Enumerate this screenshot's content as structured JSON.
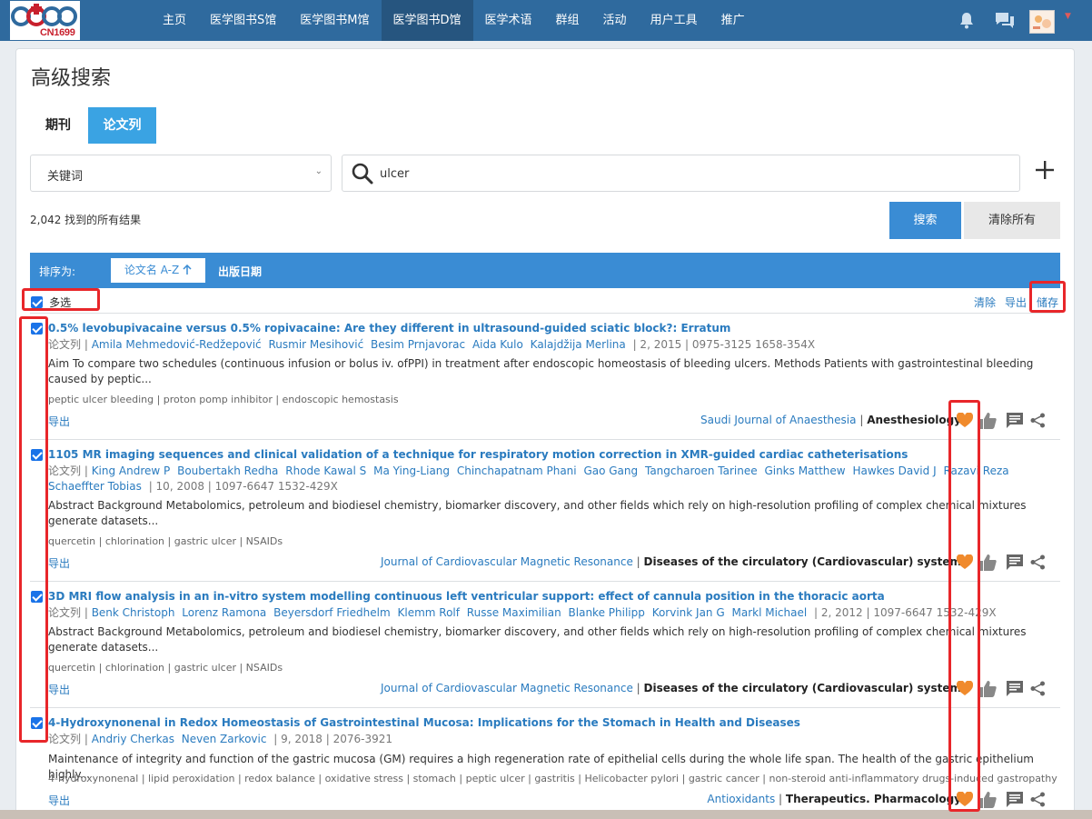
{
  "logo": {
    "text": "CN1699"
  },
  "nav": {
    "items": [
      "主页",
      "医学图书S馆",
      "医学图书M馆",
      "医学图书D馆",
      "医学术语",
      "群组",
      "活动",
      "用户工具",
      "推广"
    ],
    "active_index": 3
  },
  "page": {
    "title": "高级搜索",
    "tabs": [
      "期刊",
      "论文列"
    ],
    "active_tab_index": 1,
    "field_select": "关键词",
    "search_value": "ulcer",
    "result_count": "2,042 找到的所有结果",
    "search_button": "搜索",
    "clear_all_button": "清除所有"
  },
  "sort": {
    "label": "排序为:",
    "option_title": "论文名 A-Z",
    "option_date": "出版日期"
  },
  "list_actions": {
    "multi_select": "多选",
    "clear": "清除",
    "export": "导出",
    "save": "储存"
  },
  "results": [
    {
      "title": "0.5% levobupivacaine versus 0.5% ropivacaine: Are they different in ultrasound-guided sciatic block?: Erratum",
      "type": "论文列 |",
      "authors": [
        "Amila Mehmedović-Redžepović",
        "Rusmir Mesihović",
        "Besim Prnjavorac",
        "Aida Kulo",
        "Kalajdžija Merlina"
      ],
      "meta": "| 2, 2015 | 0975-3125 1658-354X",
      "abstract": "Aim To compare two schedules (continuous infusion or bolus iv. ofPPI) in treatment after endoscopic homeostasis of bleeding ulcers. Methods Patients with gastrointestinal bleeding caused by peptic...",
      "keywords": "peptic ulcer bleeding | proton pomp inhibitor | endoscopic hemostasis",
      "export": "导出",
      "journal": "Saudi Journal of Anaesthesia",
      "category": "Anesthesiology"
    },
    {
      "title": "1105 MR imaging sequences and clinical validation of a technique for respiratory motion correction in XMR-guided cardiac catheterisations",
      "type": "论文列 |",
      "authors": [
        "King Andrew P",
        "Boubertakh Redha",
        "Rhode Kawal S",
        "Ma Ying-Liang",
        "Chinchapatnam Phani",
        "Gao Gang",
        "Tangcharoen Tarinee",
        "Ginks Matthew",
        "Hawkes David J",
        "Razavi Reza",
        "Schaeffter Tobias"
      ],
      "meta": "| 10, 2008 | 1097-6647 1532-429X",
      "abstract": "Abstract Background Metabolomics, petroleum and biodiesel chemistry, biomarker discovery, and other fields which rely on high-resolution profiling of complex chemical mixtures generate datasets...",
      "keywords": "quercetin | chlorination | gastric ulcer | NSAIDs",
      "export": "导出",
      "journal": "Journal of Cardiovascular Magnetic Resonance",
      "category": "Diseases of the circulatory (Cardiovascular) system"
    },
    {
      "title": "3D MRI flow analysis in an in-vitro system modelling continuous left ventricular support: effect of cannula position in the thoracic aorta",
      "type": "论文列 |",
      "authors": [
        "Benk Christoph",
        "Lorenz Ramona",
        "Beyersdorf Friedhelm",
        "Klemm Rolf",
        "Russe Maximilian",
        "Blanke Philipp",
        "Korvink Jan G",
        "Markl Michael"
      ],
      "meta": "| 2, 2012 | 1097-6647 1532-429X",
      "abstract": "Abstract Background Metabolomics, petroleum and biodiesel chemistry, biomarker discovery, and other fields which rely on high-resolution profiling of complex chemical mixtures generate datasets...",
      "keywords": "quercetin | chlorination | gastric ulcer | NSAIDs",
      "export": "导出",
      "journal": "Journal of Cardiovascular Magnetic Resonance",
      "category": "Diseases of the circulatory (Cardiovascular) system"
    },
    {
      "title": "4-Hydroxynonenal in Redox Homeostasis of Gastrointestinal Mucosa: Implications for the Stomach in Health and Diseases",
      "type": "论文列 |",
      "authors": [
        "Andriy Cherkas",
        "Neven Zarkovic"
      ],
      "meta": "| 9, 2018 | 2076-3921",
      "abstract": "Maintenance of integrity and function of the gastric mucosa (GM) requires a high regeneration rate of epithelial cells during the whole life span. The health of the gastric epithelium highly...",
      "keywords": "4-hydroxynonenal | lipid peroxidation | redox balance | oxidative stress | stomach | peptic ulcer | gastritis | Helicobacter pylori | gastric cancer | non-steroid anti-inflammatory drugs-induced gastropathy",
      "export": "导出",
      "journal": "Antioxidants",
      "category": "Therapeutics. Pharmacology"
    }
  ],
  "colors": {
    "nav_bg": "#2f6a9e",
    "accent_blue": "#3a8cd4",
    "link_blue": "#2a7bbf",
    "heart_orange": "#f08a2c",
    "highlight_red": "#e8262a"
  },
  "icons": [
    "bell-icon",
    "chat-icon",
    "search-icon",
    "plus-icon",
    "arrow-up-icon",
    "heart-icon",
    "thumbs-up-icon",
    "comment-icon",
    "share-icon"
  ]
}
